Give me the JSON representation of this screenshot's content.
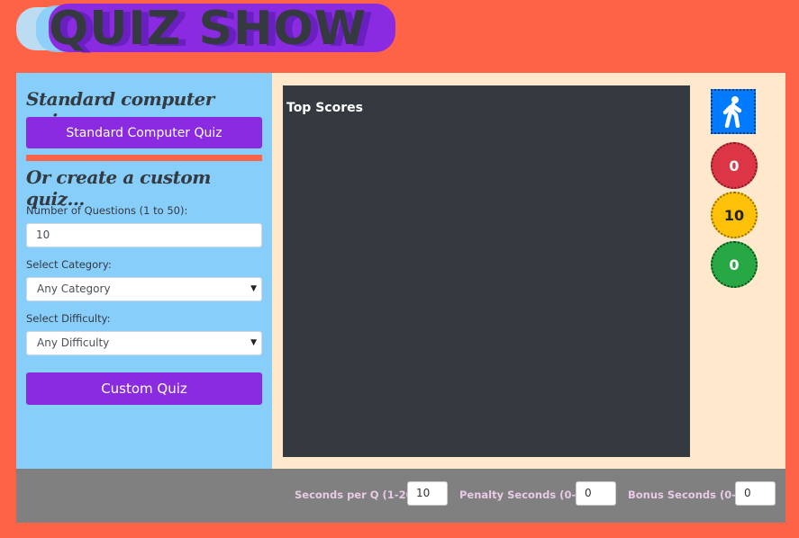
{
  "app": {
    "logo_text": "QUIZ SHOW"
  },
  "standard": {
    "heading": "Standard computer quiz...",
    "button": "Standard Computer Quiz"
  },
  "custom": {
    "heading": "Or create a custom quiz...",
    "questions_label": "Number of Questions (1 to 50):",
    "questions_value": "10",
    "category_label": "Select Category:",
    "category_value": "Any Category",
    "difficulty_label": "Select Difficulty:",
    "difficulty_value": "Any Difficulty",
    "button": "Custom Quiz"
  },
  "scores": {
    "title": "Top Scores"
  },
  "status": {
    "red_count": "0",
    "yellow_count": "10",
    "green_count": "0",
    "walk_icon": "walking-person-icon"
  },
  "settings": {
    "seconds_label": "Seconds per Q (1-20)",
    "seconds_value": "10",
    "penalty_label": "Penalty Seconds (0-5)",
    "penalty_value": "0",
    "bonus_label": "Bonus Seconds (0-5)",
    "bonus_value": "0"
  },
  "colors": {
    "background": "#ff6347",
    "purple": "#8a2be2",
    "sidebar": "#87cefa",
    "dark_panel": "#343a40",
    "red": "#dc3545",
    "yellow": "#ffc107",
    "green": "#28a745",
    "blue": "#007bff"
  }
}
